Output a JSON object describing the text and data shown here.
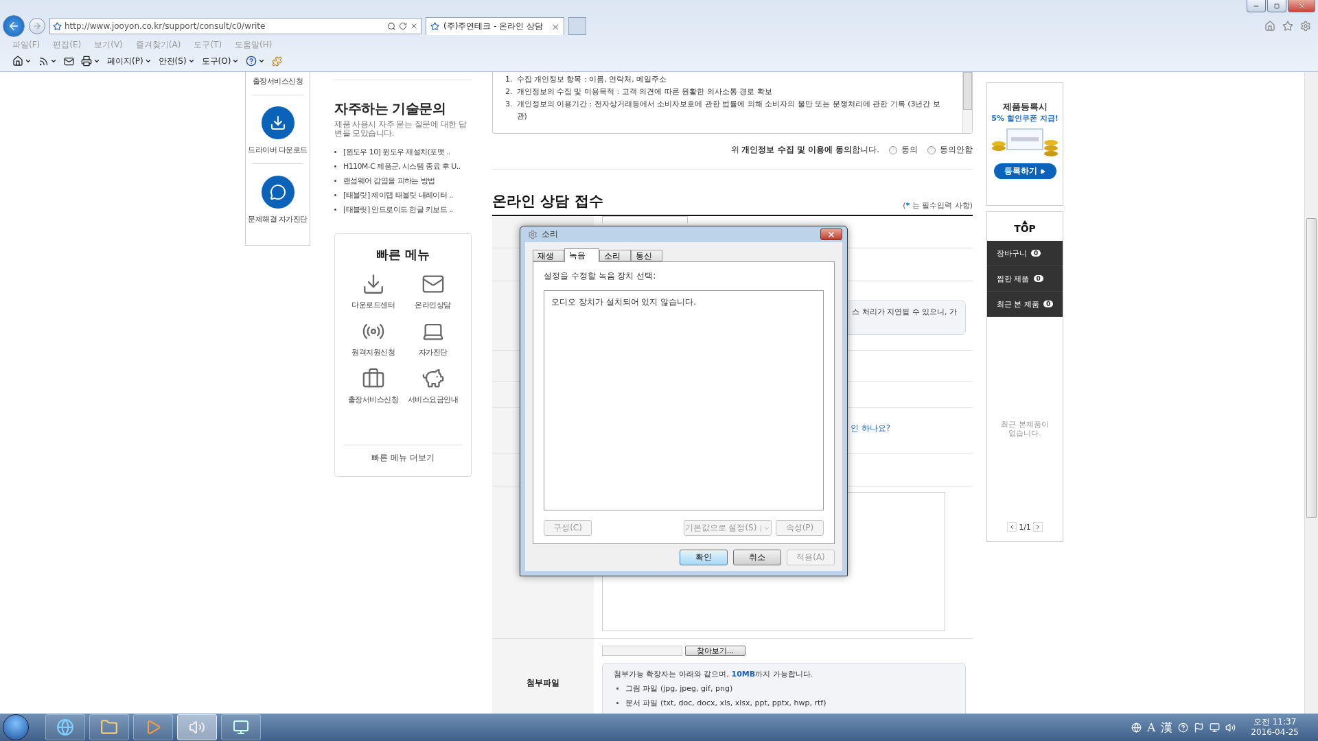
{
  "browser": {
    "url": "http://www.jooyon.co.kr/support/consult/c0/write",
    "tabs": [
      {
        "title": "(주)주연테크 - 온라인 상담",
        "close": "×",
        "selected": true
      }
    ],
    "menu": [
      "파일(F)",
      "편집(E)",
      "보기(V)",
      "즐겨찾기(A)",
      "도구(T)",
      "도움말(H)"
    ],
    "toolbar": [
      {
        "kind": "home",
        "dropdown": true
      },
      {
        "kind": "feed",
        "dropdown": true
      },
      {
        "kind": "mail",
        "dropdown": false
      },
      {
        "kind": "print",
        "dropdown": true
      },
      {
        "kind": "menu",
        "label": "페이지(P)",
        "dropdown": true
      },
      {
        "kind": "menu",
        "label": "안전(S)",
        "dropdown": true
      },
      {
        "kind": "menu",
        "label": "도구(O)",
        "dropdown": true
      },
      {
        "kind": "help",
        "dropdown": true
      },
      {
        "kind": "addon",
        "dropdown": false
      }
    ]
  },
  "sidebar": {
    "items": [
      {
        "kind": "service",
        "label": "출장서비스신청"
      },
      {
        "kind": "download",
        "label": "드라이버 다운로드"
      },
      {
        "kind": "diagnose",
        "label": "문제해결 자가진단"
      }
    ]
  },
  "faq": {
    "title": "자주하는 기술문의",
    "description": "제품 사용시 자주 묻는 질문에 대한 답변을 모았습니다.",
    "items": [
      "[윈도우 10] 윈도우 재설치(포맷 ..",
      "H110M-C 제품군, 시스템 종료 후 U..",
      "랜섬웨어 감염을 피하는 방법",
      "[태블릿] 제이탭 태블릿 내레이터 ..",
      "[태블릿] 안드로이드 한글 키보드 .."
    ]
  },
  "quick_menu": {
    "title": "빠른 메뉴",
    "items": [
      {
        "kind": "download",
        "label": "다운로드센터"
      },
      {
        "kind": "mail",
        "label": "온라인상담"
      },
      {
        "kind": "remote",
        "label": "원격지원신청"
      },
      {
        "kind": "laptop",
        "label": "자가진단"
      },
      {
        "kind": "briefcase",
        "label": "출장서비스신청"
      },
      {
        "kind": "piggy",
        "label": "서비스요금안내"
      }
    ],
    "more": "빠른 메뉴 더보기"
  },
  "privacy": {
    "items": [
      {
        "number": "1.",
        "text": "수집 개인정보 항목 : 이름, 연락처, 메일주소"
      },
      {
        "number": "2.",
        "text": "개인정보의 수집 및 이용목적 : 고객 의견에 따른 원활한 의사소통 경로 확보"
      },
      {
        "number": "3.",
        "text": "개인정보의 이용기간 : 전자상거래등에서 소비자보호에 관한 법률에 의해 소비자의 불만 또는 분쟁처리에 관한 기록 (3년간 보관)"
      }
    ],
    "agreement": "위 **개인정보 수집 및 이용에 동의**합니다.",
    "options": [
      {
        "label": "동의",
        "selected": false
      },
      {
        "label": "동의안함",
        "selected": false
      }
    ]
  },
  "form": {
    "title": "온라인 상담 접수",
    "required_note_mark": "*",
    "required_note": "는 필수입력 사항)",
    "required_note_open": "(",
    "partial_note": "스 처리가 지연될 수 있으니, 가",
    "partial_link": "인 하나요?",
    "attachment_label": "첨부파일",
    "browse": "찾아보기...",
    "attachment_info": "첨부가능 확장자는 아래와 같으며, **10MB**까지 가능합니다.",
    "attachment_types": [
      "그림 파일 (jpg, jpeg, gif, png)",
      "문서 파일 (txt, doc, docx, xls, xlsx, ppt, pptx, hwp, rtf)"
    ]
  },
  "right": {
    "ad_line1": "제품등록시",
    "ad_line2": "5% 할인쿠폰 지급!",
    "ad_button": "등록하기",
    "top": "TOP",
    "counters": [
      {
        "label": "장바구니",
        "count": "0"
      },
      {
        "label": "찜한 제품",
        "count": "0"
      },
      {
        "label": "최근 본 제품",
        "count": "0"
      }
    ],
    "empty": "최근 본제품이 없습니다.",
    "page": "1/1"
  },
  "dialog": {
    "title": "소리",
    "tabs": [
      {
        "label": "재생",
        "selected": false
      },
      {
        "label": "녹음",
        "selected": true
      },
      {
        "label": "소리",
        "selected": false
      },
      {
        "label": "통신",
        "selected": false
      }
    ],
    "prompt": "설정을 수정할 녹음 장치 선택:",
    "empty_message": "오디오 장치가 설치되어 있지 않습니다.",
    "device_buttons": [
      {
        "label": "구성(C)",
        "disabled": true
      },
      {
        "label": "기본값으로 설정(S)",
        "disabled": true,
        "kind": "split"
      },
      {
        "label": "속성(P)",
        "disabled": true
      }
    ],
    "buttons": [
      {
        "label": "확인",
        "disabled": false,
        "default": true
      },
      {
        "label": "취소",
        "disabled": false,
        "default": false
      },
      {
        "label": "적용(A)",
        "disabled": true,
        "default": false
      }
    ]
  },
  "taskbar": {
    "apps": [
      {
        "kind": "ie",
        "active": false
      },
      {
        "kind": "folder",
        "active": false
      },
      {
        "kind": "media",
        "active": false
      },
      {
        "kind": "sound",
        "active": true
      },
      {
        "kind": "control",
        "active": false
      }
    ],
    "ime": [
      "A",
      "漢"
    ],
    "time": "오전 11:37",
    "date": "2016-04-25"
  }
}
